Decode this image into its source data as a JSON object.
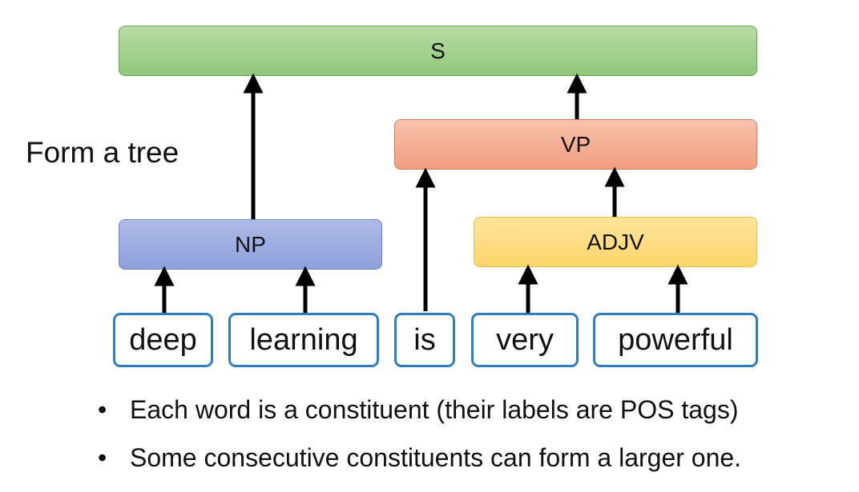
{
  "side_label": "Form a tree",
  "nodes": {
    "s": "S",
    "vp": "VP",
    "np": "NP",
    "adjv": "ADJV"
  },
  "words": [
    "deep",
    "learning",
    "is",
    "very",
    "powerful"
  ],
  "bullets": [
    "Each word is a constituent (their labels are POS tags)",
    "Some consecutive constituents can form a larger one."
  ],
  "colors": {
    "s": "#a6d18f",
    "vp": "#f4ae95",
    "np": "#9fb0e3",
    "adjv": "#fedd82",
    "word_border": "#2f7fc0",
    "arrow": "#000000"
  }
}
